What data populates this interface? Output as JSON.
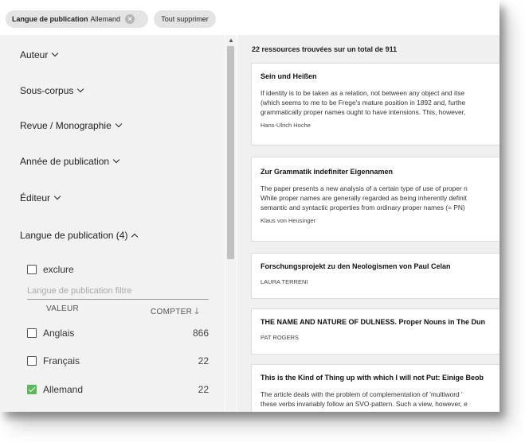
{
  "chips": {
    "filter_label": "Langue de publication",
    "filter_value": "Allemand",
    "clear_all": "Tout supprimer"
  },
  "facets": {
    "auteur": "Auteur",
    "sous_corpus": "Sous-corpus",
    "revue": "Revue / Monographie",
    "annee": "Année de publication",
    "editeur": "Éditeur",
    "langue": "Langue de publication (4)"
  },
  "language_facet": {
    "exclude_label": "exclure",
    "filter_placeholder": "Langue de publication filtre",
    "col_value": "VALEUR",
    "col_count": "COMPTER",
    "options": [
      {
        "label": "Anglais",
        "count": "866",
        "checked": false
      },
      {
        "label": "Français",
        "count": "22",
        "checked": false
      },
      {
        "label": "Allemand",
        "count": "22",
        "checked": true
      }
    ]
  },
  "results": {
    "summary": "22 ressources trouvées sur un total de 911",
    "items": [
      {
        "title": "Sein und Heißen",
        "lines": [
          "If identity is to be taken as a relation, not between any object and itse",
          "(which seems to me to be Frege's mature position in 1892 and, furthe",
          "grammatically proper names ought to have intensions. This, however,"
        ],
        "author": "Hans-Ulrich Hoche"
      },
      {
        "title": "Zur Grammatik indefiniter Eigennamen",
        "lines": [
          "The paper presents a new analysis of a certain type of use of proper n",
          "While proper names are generally regarded as being inherently definit",
          "semantic and syntactic properties from ordinary proper names (= PN)"
        ],
        "author": "Klaus von Heusinger"
      },
      {
        "title": "Forschungsprojekt zu den Neologismen von Paul Celan",
        "lines": [],
        "author": "LAURA TERRENI"
      },
      {
        "title": "THE NAME AND NATURE OF DULNESS. Proper Nouns in The Dun",
        "lines": [],
        "author": "PAT ROGERS"
      },
      {
        "title": "This is the Kind of Thing up with which I will not Put: Einige Beob",
        "lines": [
          "The article deals with the problem of complementation of 'multiword '",
          "these verbs invariably follow an SVO-pattern. Such a view, however, e"
        ],
        "author": ""
      }
    ]
  }
}
